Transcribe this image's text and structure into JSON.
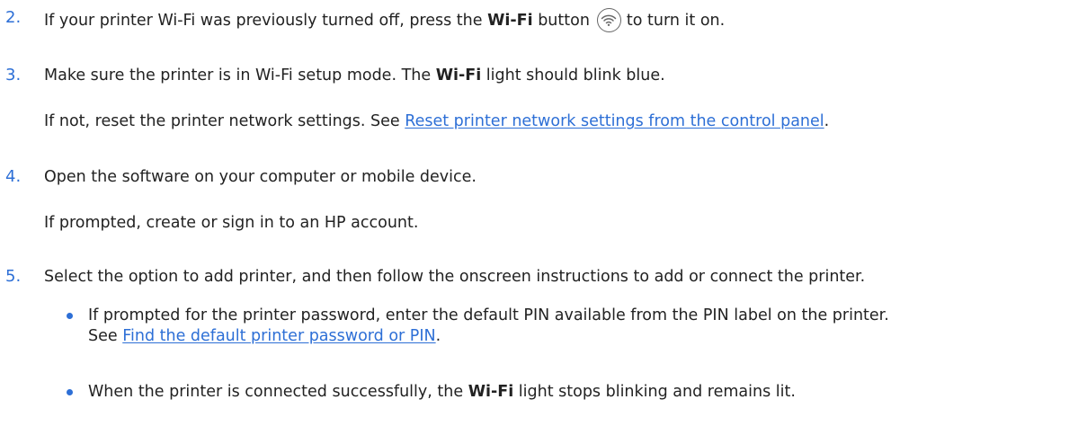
{
  "steps": [
    {
      "number": "2.",
      "line1_a": "If your printer Wi-Fi was previously turned off, press the ",
      "line1_bold": "Wi-Fi",
      "line1_b": " button",
      "line1_c": "to turn it on."
    },
    {
      "number": "3.",
      "line1_a": "Make sure the printer is in Wi-Fi setup mode. The ",
      "line1_bold": "Wi-Fi",
      "line1_b": " light should blink blue.",
      "line2_a": "If not, reset the printer network settings. See ",
      "line2_link": "Reset printer network settings from the control panel",
      "line2_b": "."
    },
    {
      "number": "4.",
      "line1": "Open the software on your computer or mobile device.",
      "line2": "If prompted, create or sign in to an HP account."
    },
    {
      "number": "5.",
      "line1": "Select the option to add printer, and then follow the onscreen instructions to add or connect the printer.",
      "bullets": [
        {
          "line1": "If prompted for the printer password, enter the default PIN available from the PIN label on the printer.",
          "line2_a": "See ",
          "line2_link": "Find the default printer password or PIN",
          "line2_b": "."
        },
        {
          "line_a": "When the printer is connected successfully, the ",
          "line_bold": "Wi-Fi",
          "line_b": " light stops blinking and remains lit."
        }
      ]
    }
  ],
  "icons": {
    "wifi_button": "wifi-icon"
  },
  "colors": {
    "accent": "#2d6fd6",
    "text": "#222222"
  }
}
